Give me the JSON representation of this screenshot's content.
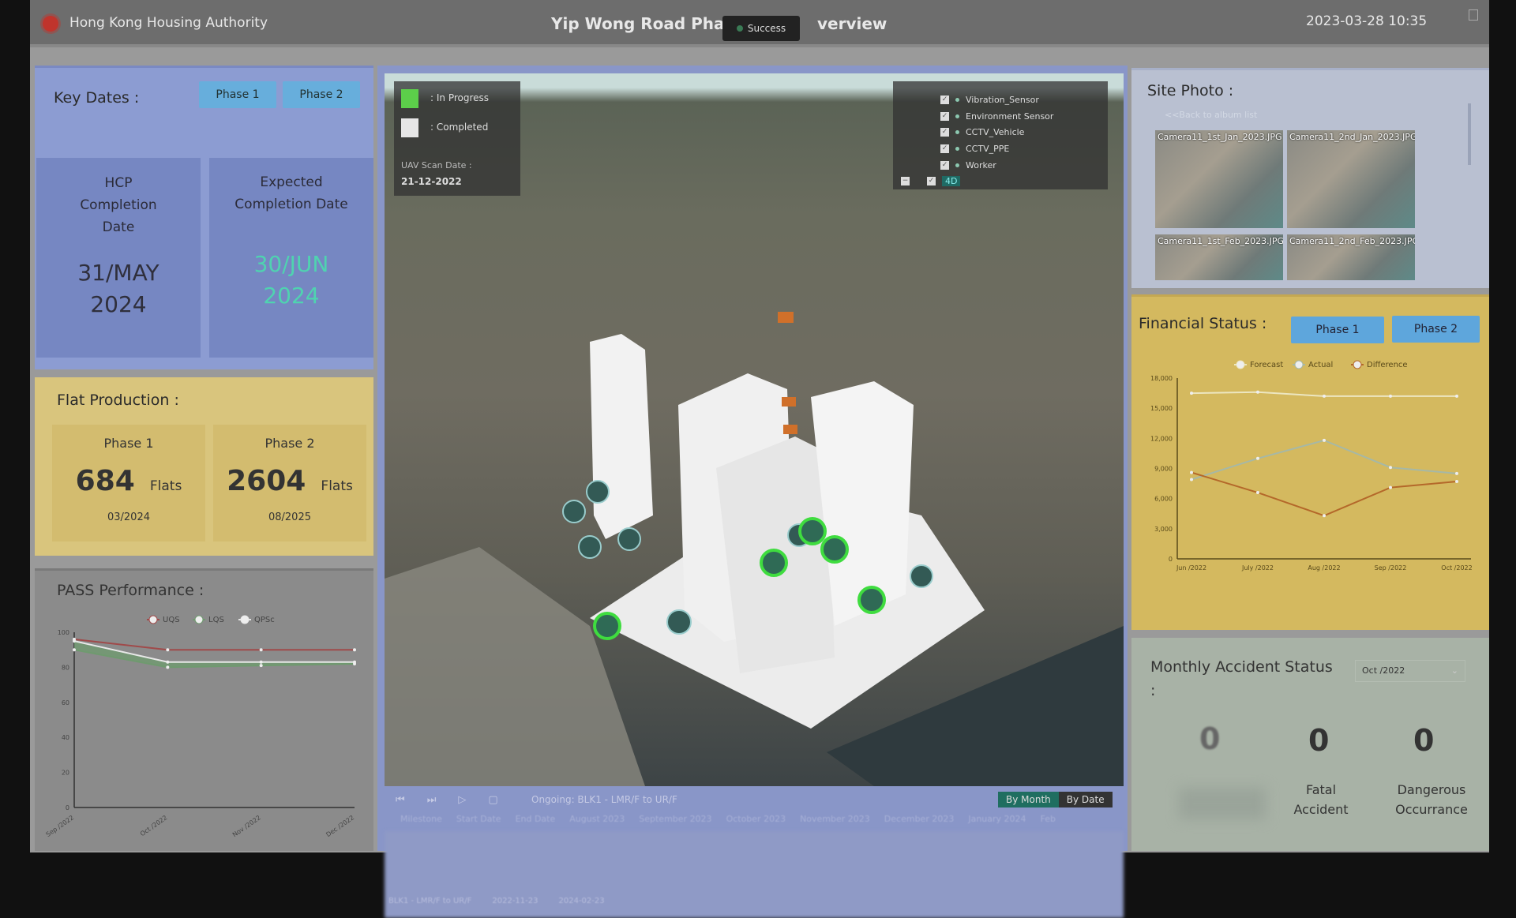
{
  "header": {
    "org": "Hong Kong Housing Authority",
    "title": "Yip Wong Road Phase 1 & 2 Overview",
    "title_visible_left": "Yip Wong Road Phase",
    "title_visible_right": "verview",
    "toast": "Success",
    "datetime": "2023-03-28 10:35"
  },
  "key_dates": {
    "title": "Key Dates :",
    "tabs": [
      "Phase 1",
      "Phase 2"
    ],
    "hcp_label": "HCP Completion Date",
    "hcp_date_day": "31/MAY",
    "hcp_date_year": "2024",
    "expected_label": "Expected Completion Date",
    "expected_date_day": "30/JUN",
    "expected_date_year": "2024",
    "expected_color": "#4fd3b0"
  },
  "flat_production": {
    "title": "Flat Production :",
    "phases": [
      {
        "label": "Phase 1",
        "count": "684",
        "unit": "Flats",
        "date": "03/2024"
      },
      {
        "label": "Phase 2",
        "count": "2604",
        "unit": "Flats",
        "date": "08/2025"
      }
    ]
  },
  "map": {
    "legend": {
      "in_progress": ": In Progress",
      "completed": ": Completed",
      "in_progress_color": "#5ccf4a",
      "completed_color": "#e6e6e6",
      "scan_label": "UAV Scan Date :",
      "scan_date": "21-12-2022"
    },
    "layers": [
      {
        "label": "Vibration_Sensor",
        "checked": true
      },
      {
        "label": "Environment Sensor",
        "checked": true
      },
      {
        "label": "CCTV_Vehicle",
        "checked": true
      },
      {
        "label": "CCTV_PPE",
        "checked": true
      },
      {
        "label": "Worker",
        "checked": true
      }
    ],
    "layer_4d": "4D"
  },
  "timeline": {
    "status": "Ongoing: BLK1 - LMR/F to UR/F",
    "toggle": [
      "By Month",
      "By Date"
    ],
    "active_toggle": "By Month",
    "columns": [
      "Milestone",
      "Start Date",
      "End Date",
      "August 2023",
      "September 2023",
      "October 2023",
      "November 2023",
      "December 2023",
      "January 2024",
      "Feb"
    ],
    "row": {
      "name": "BLK1 - LMR/F to UR/F",
      "start": "2022-11-23",
      "end": "2024-02-23"
    }
  },
  "site_photo": {
    "title": "Site Photo :",
    "back": "<<Back to album list",
    "photos": [
      "Camera11_1st_Jan_2023.JPG",
      "Camera11_2nd_Jan_2023.JPG",
      "Camera11_1st_Feb_2023.JPG",
      "Camera11_2nd_Feb_2023.JPG"
    ]
  },
  "financial": {
    "title": "Financial Status :",
    "tabs": [
      "Phase 1",
      "Phase 2"
    ]
  },
  "accident": {
    "title": "Monthly Accident Status",
    "colon": ":",
    "month": "Oct /2022",
    "items": [
      {
        "value": "0",
        "label": ""
      },
      {
        "value": "0",
        "label": "Fatal Accident"
      },
      {
        "value": "0",
        "label": "Dangerous Occurrance"
      }
    ]
  },
  "pass": {
    "title": "PASS Performance :"
  },
  "chart_data": [
    {
      "id": "pass",
      "type": "line",
      "title": "",
      "categories": [
        "Sep /2022",
        "Oct /2022",
        "Nov /2022",
        "Dec /2022"
      ],
      "ylim": [
        0,
        100
      ],
      "yticks": [
        0,
        20,
        40,
        60,
        80,
        100
      ],
      "legend": "top",
      "grid": false,
      "series": [
        {
          "name": "UQS",
          "values": [
            96,
            90,
            90,
            90
          ],
          "color": "#a04a4a"
        },
        {
          "name": "LQS",
          "values": [
            90,
            80,
            81,
            82
          ],
          "color": "#6f9a6f",
          "fill": true
        },
        {
          "name": "QPSc",
          "values": [
            95,
            83,
            83,
            83
          ],
          "color": "#e8e8e8"
        }
      ]
    },
    {
      "id": "financial",
      "type": "line",
      "title": "",
      "categories": [
        "Jun /2022",
        "July /2022",
        "Aug /2022",
        "Sep /2022",
        "Oct /2022"
      ],
      "ylim": [
        0,
        18000
      ],
      "yticks": [
        "0",
        "3,000",
        "6,000",
        "9,000",
        "12,000",
        "15,000",
        "18,000"
      ],
      "legend": "top",
      "grid": false,
      "series": [
        {
          "name": "Forecast",
          "values": [
            16500,
            16600,
            16200,
            16200,
            16200
          ],
          "color": "#ece6c0"
        },
        {
          "name": "Actual",
          "values": [
            7900,
            10000,
            11800,
            9100,
            8500
          ],
          "color": "#a6b8a6"
        },
        {
          "name": "Difference",
          "values": [
            8600,
            6600,
            4300,
            7100,
            7700
          ],
          "color": "#b4682a"
        }
      ]
    }
  ]
}
